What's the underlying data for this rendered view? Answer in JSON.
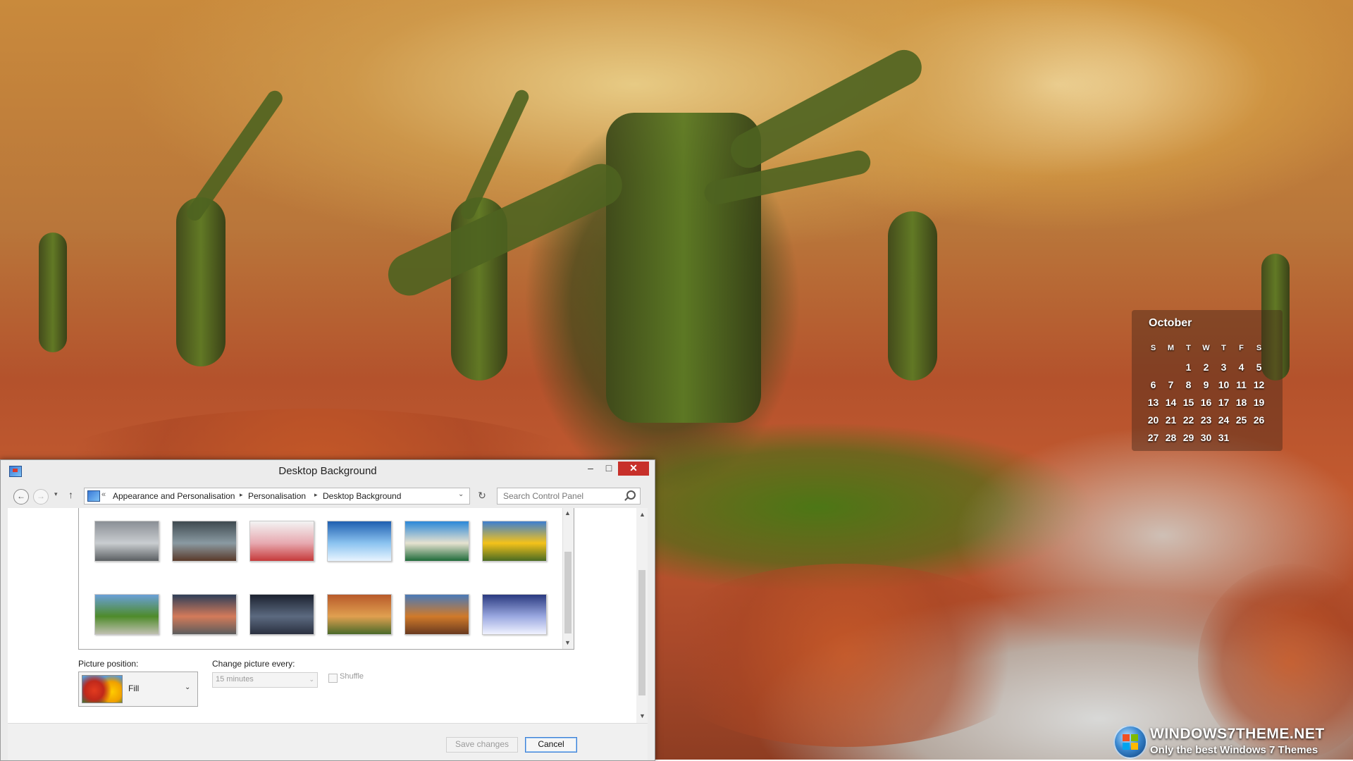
{
  "calendar": {
    "month": "October",
    "weekdays": [
      "S",
      "M",
      "T",
      "W",
      "T",
      "F",
      "S"
    ],
    "weeks": [
      [
        "",
        "",
        "",
        "1",
        "2",
        "3",
        "4",
        "5"
      ],
      [
        "6",
        "7",
        "8",
        "9",
        "10",
        "11",
        "12"
      ],
      [
        "13",
        "14",
        "15",
        "16",
        "17",
        "18",
        "19"
      ],
      [
        "20",
        "21",
        "22",
        "23",
        "24",
        "25",
        "26"
      ],
      [
        "27",
        "28",
        "29",
        "30",
        "31"
      ]
    ]
  },
  "watermark": {
    "title": "WINDOWS7THEME.NET",
    "subtitle": "Only the best Windows 7 Themes"
  },
  "window": {
    "title": "Desktop Background",
    "controls": {
      "minimize": "–",
      "maximize": "□",
      "close": "✕"
    }
  },
  "navigation": {
    "back_glyph": "←",
    "forward_glyph": "→",
    "recent_glyph": "▾",
    "up_glyph": "↑",
    "overflow": "«",
    "breadcrumbs": [
      "Appearance and Personalisation",
      "Personalisation",
      "Desktop Background"
    ],
    "crumb_arrow": "▸",
    "dropdown_glyph": "⌄",
    "refresh_glyph": "↻",
    "search_placeholder": "Search Control Panel"
  },
  "gallery": {
    "thumbnails": [
      {
        "name": "frosted-trees",
        "colors": [
          "#8a8f95",
          "#c9cdd0",
          "#5b5f62"
        ]
      },
      {
        "name": "misty-lake-trees",
        "colors": [
          "#3f4a50",
          "#8a9aa2",
          "#5a3a2a"
        ]
      },
      {
        "name": "cherry-blossom",
        "colors": [
          "#f3f3f3",
          "#e7a9b0",
          "#c63a3a"
        ]
      },
      {
        "name": "ocean-sunset",
        "colors": [
          "#1f5fb0",
          "#8bc3f0",
          "#e8f4ff"
        ]
      },
      {
        "name": "tropical-beach",
        "colors": [
          "#2b88d8",
          "#e6e2d0",
          "#1f6b3a"
        ]
      },
      {
        "name": "sunflower",
        "colors": [
          "#3d7fd0",
          "#f4c21a",
          "#4a6b22"
        ]
      },
      {
        "name": "mountain-road",
        "colors": [
          "#6aa0d8",
          "#4e8b2a",
          "#c0c0b0"
        ]
      },
      {
        "name": "railway-tracks",
        "colors": [
          "#2e3e58",
          "#d47b5a",
          "#5c5c5c"
        ]
      },
      {
        "name": "city-night",
        "colors": [
          "#1c2230",
          "#5c6a80",
          "#2a3040"
        ]
      },
      {
        "name": "autumn-forest",
        "colors": [
          "#b85a2a",
          "#e0a050",
          "#4a6a2a"
        ]
      },
      {
        "name": "autumn-village",
        "colors": [
          "#4a7ab8",
          "#d07a2a",
          "#6a3a20"
        ]
      },
      {
        "name": "winter-night",
        "colors": [
          "#2a3a80",
          "#9aa8e0",
          "#f0f2ff"
        ]
      }
    ]
  },
  "picture_position": {
    "label": "Picture position:",
    "value": "Fill",
    "dropdown_glyph": "⌄"
  },
  "change_picture": {
    "label": "Change picture every:",
    "value": "15 minutes",
    "dropdown_glyph": "⌄"
  },
  "shuffle": {
    "label": "Shuffle",
    "checked": false
  },
  "buttons": {
    "save": "Save changes",
    "cancel": "Cancel"
  },
  "scroll_glyphs": {
    "up": "▲",
    "down": "▼"
  }
}
